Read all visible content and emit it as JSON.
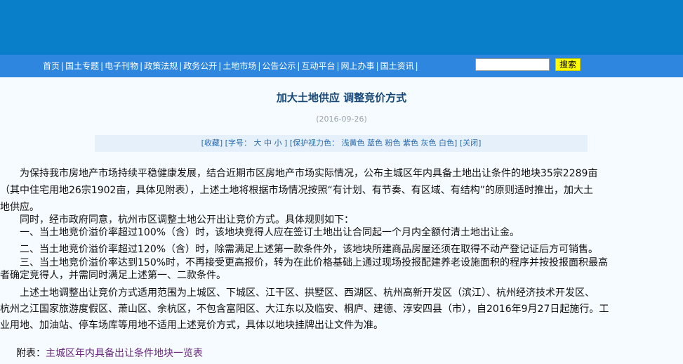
{
  "nav": {
    "items": [
      "首页",
      "国土专题",
      "电子刊物",
      "政策法规",
      "政务公开",
      "土地市场",
      "公告公示",
      "互动平台",
      "网上办事",
      "国土资讯"
    ],
    "separator": "|",
    "search_placeholder": "",
    "search_button": "搜索"
  },
  "article": {
    "title": "加大土地供应 调整竞价方式",
    "date": "(2016-09-26)",
    "toolbar": {
      "collect": "[收藏]",
      "font_label": "[字号：",
      "font_big": "大",
      "font_mid": "中",
      "font_small": "小",
      "font_close": "]",
      "protect_label": "[保护视力色：",
      "colors": [
        "浅黄色",
        "蓝色",
        "粉色",
        "紫色",
        "灰色",
        "白色"
      ],
      "protect_close": "]",
      "close": "[关闭]"
    },
    "lines": [
      "　　为保持我市房地产市场持续平稳健康发展，结合近期市区房地产市场实际情况，公布主城区年内具备土地出让条件的地块35宗2289亩",
      "（其中住宅用地26宗1902亩，具体见附表），上述土地将根据市场情况按照“有计划、有节奏、有区域、有结构”的原则适时推出，加大土",
      "地供应。",
      "　　同时，经市政府同意，杭州市区调整土地公开出让竞价方式。具体规则如下：",
      "　　一、当土地竞价溢价率超过100%（含）时，该地块竞得人应在签订土地出让合同起一个月内全额付清土地出让金。",
      "　　二、当土地竞价溢价率超过120%（含）时，除需满足上述第一款条件外，该地块所建商品房屋还须在取得不动产登记证后方可销售。",
      "　　三、当土地竞价溢价率达到150%时，不再接受更高报价，转为在此价格基础上通过现场投报配建养老设施面积的程序并按投报面积最高",
      "者确定竞得人，并需同时满足上述第一、二款条件。",
      "　　上述土地调整出让竞价方式适用范围为上城区、下城区、江干区、拱墅区、西湖区、杭州高新开发区（滨江）、杭州经济技术开发区、",
      "杭州之江国家旅游度假区、萧山区、余杭区，不包含富阳区、大江东以及临安、桐庐、建德、淳安四县（市），自2016年9月27日起施行。工",
      "业用地、加油站、停车场库等用地不适用上述竞价方式，具体以地块挂牌出让文件为准。"
    ],
    "attachment_label": "附表：",
    "attachment_link": "主城区年内具备出让条件地块一览表"
  }
}
